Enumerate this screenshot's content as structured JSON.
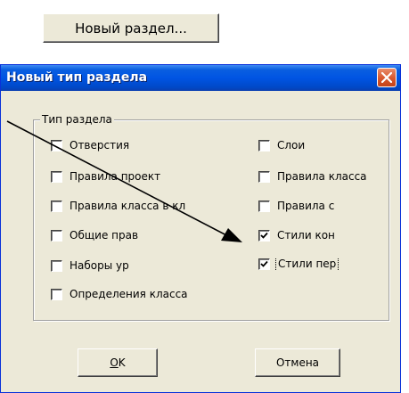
{
  "top_button": {
    "label": "Новый раздел..."
  },
  "dialog": {
    "title": "Новый тип раздела",
    "group_label": "Тип раздела",
    "checkboxes": [
      {
        "label": "Отверстия",
        "checked": false
      },
      {
        "label": "Правила проект",
        "checked": false
      },
      {
        "label": "Правила класса в кл",
        "checked": false
      },
      {
        "label": "Общие прав",
        "checked": false
      },
      {
        "label": "Наборы ур",
        "checked": false
      },
      {
        "label": "Определения класса",
        "checked": false
      },
      {
        "label": "Слои",
        "checked": false
      },
      {
        "label": "Правила класса",
        "checked": false
      },
      {
        "label": "Правила с",
        "checked": false
      },
      {
        "label": "Стили кон",
        "checked": true
      },
      {
        "label": "Стили пер",
        "checked": true
      }
    ],
    "ok_prefix": "O",
    "ok_rest": "K",
    "cancel_label": "Отмена"
  },
  "colors": {
    "titlebar": "#0054e3",
    "dialog_bg": "#ece9d8",
    "close_button": "#d8572d"
  },
  "icons": {
    "close": "close-icon",
    "check": "check-icon",
    "arrow": "arrow-annotation"
  }
}
